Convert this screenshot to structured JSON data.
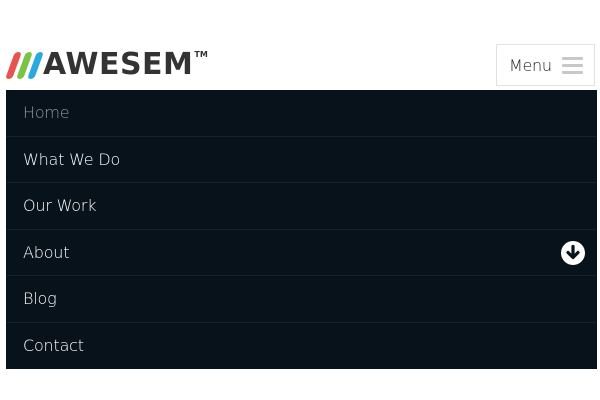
{
  "header": {
    "logo_text": "AWESEM",
    "logo_tm": "TM",
    "logo_colors": [
      "#e8534f",
      "#7cc246",
      "#2aa8e0"
    ],
    "menu_label": "Menu",
    "menu_icon": "hamburger-icon"
  },
  "nav": {
    "background": "#08121a",
    "active_color": "#8a9aa6",
    "items": [
      {
        "label": "Home",
        "active": true
      },
      {
        "label": "What We Do"
      },
      {
        "label": "Our Work"
      },
      {
        "label": "About",
        "has_submenu": true,
        "icon": "arrow-down-circle-icon"
      },
      {
        "label": "Blog"
      },
      {
        "label": "Contact"
      }
    ]
  }
}
